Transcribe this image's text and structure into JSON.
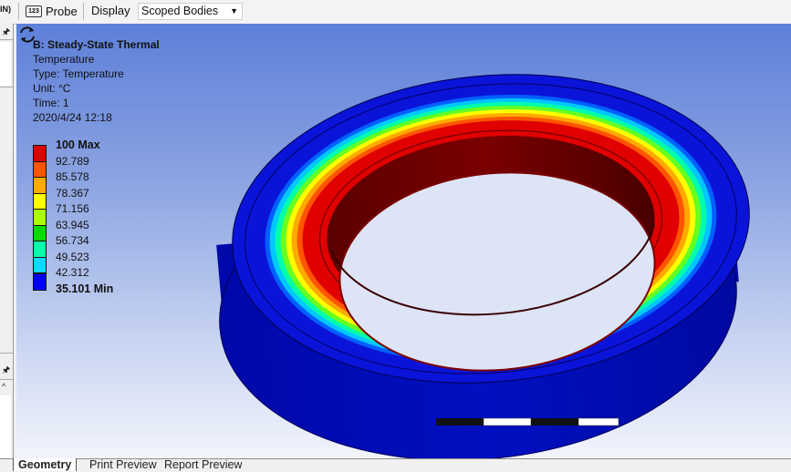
{
  "toolbar": {
    "partial_label": "IN)",
    "probe_icon_text": "123",
    "probe_label": "Probe",
    "display_label": "Display",
    "scope_value": "Scoped Bodies"
  },
  "result": {
    "title": "B: Steady-State Thermal",
    "type_name": "Temperature",
    "type_line": "Type: Temperature",
    "unit_line": "Unit: °C",
    "time_line": "Time: 1",
    "timestamp": "2020/4/24 12:18"
  },
  "legend": {
    "entries": [
      {
        "label": "100 Max",
        "color": "#e00000",
        "bold": true
      },
      {
        "label": "92.789",
        "color": "#ff5500"
      },
      {
        "label": "85.578",
        "color": "#ffaa00"
      },
      {
        "label": "78.367",
        "color": "#ffff00"
      },
      {
        "label": "71.156",
        "color": "#aaff00"
      },
      {
        "label": "63.945",
        "color": "#00dd00"
      },
      {
        "label": "56.734",
        "color": "#00ffaa"
      },
      {
        "label": "49.523",
        "color": "#00ddff"
      },
      {
        "label": "42.312",
        "color": "#0088ff"
      },
      {
        "label": "35.101 Min",
        "color": "#0000ff",
        "bold": true
      }
    ]
  },
  "tabs": [
    {
      "label": "Geometry",
      "active": true
    },
    {
      "label": "Print Preview",
      "active": false
    },
    {
      "label": "Report Preview",
      "active": false
    }
  ],
  "colors": {
    "max_red": "#e00000",
    "min_blue": "#0010c8",
    "viewport_top": "#5d80d9",
    "viewport_bottom": "#f3f5fc"
  }
}
